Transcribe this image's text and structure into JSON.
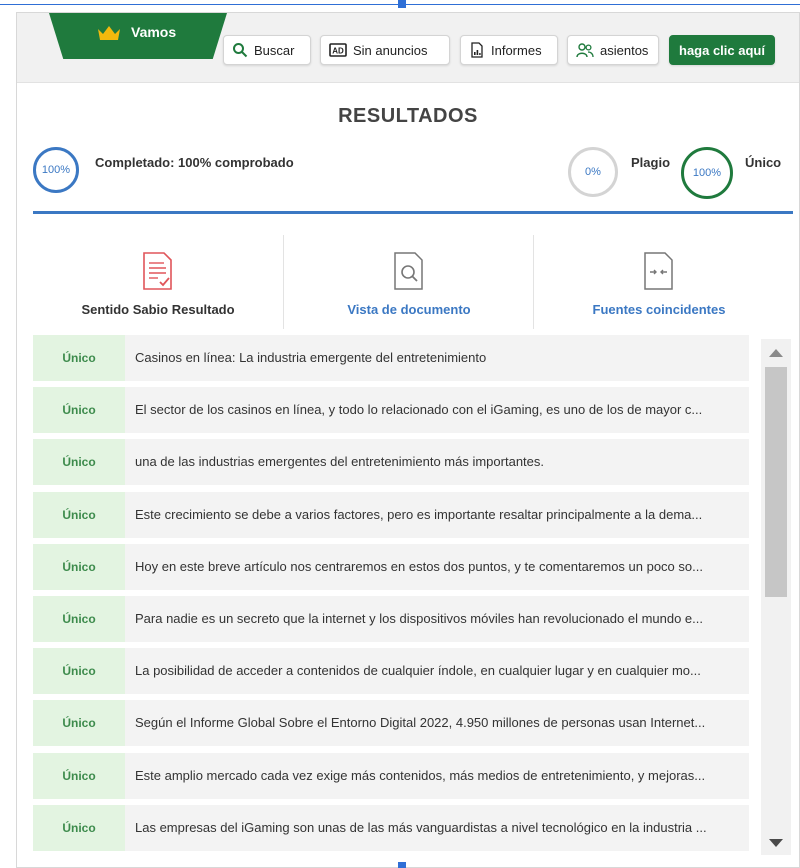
{
  "colors": {
    "brand_green": "#1f7a3d",
    "accent_blue": "#3b78c3",
    "unique_bg": "#e3f4e1",
    "unique_text": "#3d8b4c"
  },
  "header": {
    "brand_label": "Vamos",
    "brand_icon": "crown-icon",
    "buttons": [
      {
        "label": "Buscar",
        "icon": "search-icon"
      },
      {
        "label": "Sin anuncios",
        "icon": "ad-icon"
      },
      {
        "label": "Informes",
        "icon": "report-icon"
      },
      {
        "label": "asientos",
        "icon": "users-icon"
      }
    ],
    "cta_label": "haga clic aquí"
  },
  "results": {
    "title": "RESULTADOS",
    "completed": {
      "ring_value": "100%",
      "label": "Completado: 100% comprobado",
      "progress": 1.0
    },
    "plagiarism": {
      "ring_value": "0%",
      "label": "Plagio",
      "progress": 0.0
    },
    "unique": {
      "ring_value": "100%",
      "label": "Único",
      "progress": 1.0
    }
  },
  "views": [
    {
      "label": "Sentido Sabio Resultado",
      "icon": "report-check-icon"
    },
    {
      "label": "Vista de documento",
      "icon": "document-search-icon"
    },
    {
      "label": "Fuentes coincidentes",
      "icon": "compare-sources-icon"
    }
  ],
  "rows": [
    {
      "tag": "Único",
      "text": "Casinos en línea: La industria emergente del entretenimiento"
    },
    {
      "tag": "Único",
      "text": "El sector de los casinos en línea, y todo lo relacionado con el iGaming, es uno de los de mayor c..."
    },
    {
      "tag": "Único",
      "text": "una de las industrias emergentes del entretenimiento más importantes."
    },
    {
      "tag": "Único",
      "text": "Este crecimiento se debe a varios factores, pero es importante resaltar principalmente a la dema..."
    },
    {
      "tag": "Único",
      "text": "Hoy en este breve artículo nos centraremos en estos dos puntos, y te comentaremos un poco so..."
    },
    {
      "tag": "Único",
      "text": "Para nadie es un secreto que la internet y los dispositivos móviles han revolucionado el mundo e..."
    },
    {
      "tag": "Único",
      "text": "La posibilidad de acceder a contenidos de cualquier índole, en cualquier lugar y en cualquier mo..."
    },
    {
      "tag": "Único",
      "text": "Según el Informe Global Sobre el Entorno Digital 2022, 4.950 millones de personas usan Internet..."
    },
    {
      "tag": "Único",
      "text": "Este amplio mercado cada vez exige más contenidos, más medios de entretenimiento, y mejoras..."
    },
    {
      "tag": "Único",
      "text": "Las empresas del iGaming son unas de las más vanguardistas a nivel tecnológico en la industria ..."
    }
  ]
}
